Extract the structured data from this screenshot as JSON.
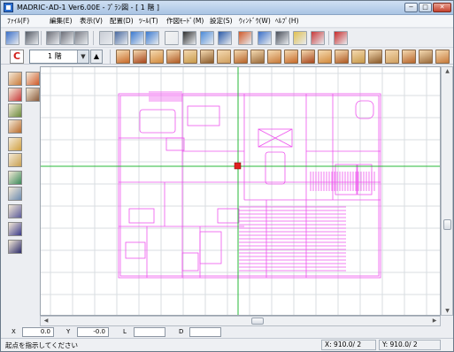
{
  "window": {
    "title": "MADRIC･AD-1 Ver6.00E - ﾌﾟﾗﾝ図 - [ 1 階 ]",
    "controls": {
      "minimize": "−",
      "maximize": "□",
      "close": "✕"
    }
  },
  "menu": [
    "ﾌｧｲﾙ(F)",
    "編集(E)",
    "表示(V)",
    "配置(D)",
    "ﾂｰﾙ(T)",
    "作図ﾓｰﾄﾞ(M)",
    "設定(S)",
    "ｳｨﾝﾄﾞｳ(W)",
    "ﾍﾙﾌﾟ(H)"
  ],
  "level": {
    "button_label": "C",
    "floor_value": "1 階",
    "dropdown_glyph": "▼",
    "up_glyph": "▲"
  },
  "toolbar1_icons": [
    "undo-icon",
    "redo-icon",
    "copy-wall-icon",
    "paste-wall-icon",
    "eraser-icon",
    "select-frame-icon",
    "zoom-icon",
    "expand-icon",
    "shrink-icon",
    "full-view-icon",
    "pointer-icon",
    "zoom-region-icon",
    "grid-snap-icon",
    "dimension-icon",
    "move-icon",
    "layer-icon",
    "view-3d-icon",
    "parts-icon",
    "color-palette-icon"
  ],
  "toolbar2_icons": [
    "wall-icon",
    "column-icon",
    "beam-icon",
    "floor-icon",
    "roof-icon",
    "stairs-icon",
    "door-icon",
    "window-icon",
    "opening-icon",
    "board-icon",
    "tile-icon",
    "fence-icon",
    "material-icon",
    "panel-icon",
    "deck-icon",
    "siding-icon",
    "rail-icon",
    "lattice-icon",
    "brick-icon",
    "stripe-icon"
  ],
  "palette_icons": [
    "house-icon",
    "door-palette-icon",
    "wall-palette-icon",
    "window-palette-icon",
    "roof-palette-icon",
    "furniture-icon",
    "stairs-palette-icon",
    "column-palette-icon",
    "fence-palette-icon",
    "garden-icon",
    "text-icon",
    "text-abc-icon",
    "text-ab-icon"
  ],
  "colors": {
    "plan": "#ee55ee",
    "axis": "#27b83a",
    "marker": "#e02020",
    "grid": "#d9dde2"
  },
  "coords": {
    "x_label": "X",
    "x_value": "0.0",
    "y_label": "Y",
    "y_value": "-0.0",
    "l_label": "L",
    "l_value": "",
    "d_label": "D",
    "d_value": ""
  },
  "status": {
    "message": "起点を指示してください",
    "x_readout": "X: 910.0/ 2",
    "y_readout": "Y: 910.0/ 2"
  }
}
